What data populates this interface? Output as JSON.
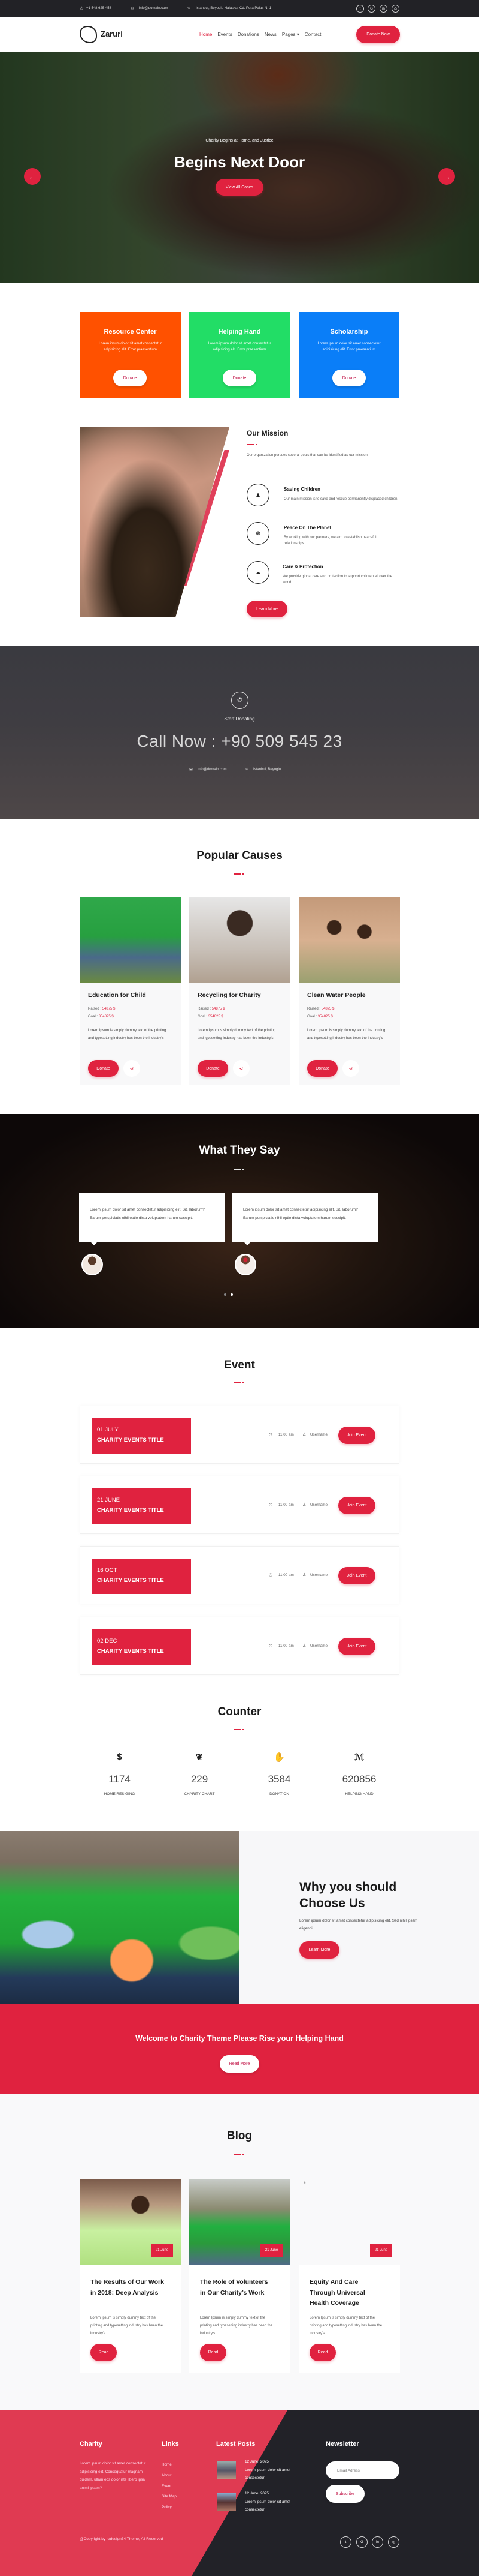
{
  "colors": {
    "accent": "#e0223f",
    "orange": "#ff5100",
    "green": "#22dd66",
    "blue": "#0a7ef8",
    "dark": "#222228",
    "footer_red": "#e03a52"
  },
  "topbar": {
    "phone": "+1 548 625 458",
    "email": "info@domain.com",
    "address": "Istanbul, Beyoglu Halaskar Cd. Pera Palas N. 1",
    "social": [
      "twitter-icon",
      "google-icon",
      "linkedin-icon",
      "instagram-icon"
    ]
  },
  "header": {
    "brand": "Zaruri",
    "nav": [
      "Home",
      "Events",
      "Donations",
      "News",
      "Pages",
      "Contact"
    ],
    "active": "Home",
    "donate_label": "Donate Now"
  },
  "hero": {
    "subtitle": "Charity Begins at Home, and Justice",
    "title": "Begins Next Door",
    "button": "View All Cases"
  },
  "features": [
    {
      "title": "Resource Center",
      "text": "Lorem ipsum dolor sit amet consectetur adipisicing elit. Error praesentium",
      "button": "Donate"
    },
    {
      "title": "Helping Hand",
      "text": "Lorem ipsum dolor sit amet consectetur adipisicing elit. Error praesentium",
      "button": "Donate"
    },
    {
      "title": "Scholarship",
      "text": "Lorem ipsum dolor sit amet consectetur adipisicing elit. Error praesentium",
      "button": "Donate"
    }
  ],
  "mission": {
    "title": "Our Mission",
    "intro": "Our organization pursues several goals that can be identified as our mission.",
    "items": [
      {
        "title": "Saving Children",
        "text": "Our main mission is to save and rescue permanently displaced children."
      },
      {
        "title": "Peace On The Planet",
        "text": "By working with our partners, we aim to establish peaceful relationships."
      },
      {
        "title": "Care & Protection",
        "text": "We provide global care and protection to support children all over the world."
      }
    ],
    "button": "Learn More"
  },
  "call": {
    "label": "Start Donating",
    "headline": "Call Now : +90 509 545 23",
    "email": "info@domain.com",
    "location": "Istanbul, Beyoglu"
  },
  "causes": {
    "title": "Popular Causes",
    "items": [
      {
        "title": "Education for Child",
        "raised_label": "Raised : ",
        "raised": "54875 $",
        "goal_label": "Goal : ",
        "goal": "354825 $",
        "text": "Lorem Ipsum is simply dummy text of the printing and typesetting industry has been the industry's",
        "button": "Donate"
      },
      {
        "title": "Recycling for Charity",
        "raised_label": "Raised : ",
        "raised": "54875 $",
        "goal_label": "Goal : ",
        "goal": "354825 $",
        "text": "Lorem Ipsum is simply dummy text of the printing and typesetting industry has been the industry's",
        "button": "Donate"
      },
      {
        "title": "Clean Water People",
        "raised_label": "Raised : ",
        "raised": "54875 $",
        "goal_label": "Goal : ",
        "goal": "354825 $",
        "text": "Lorem Ipsum is simply dummy text of the printing and typesetting industry has been the industry's",
        "button": "Donate"
      }
    ]
  },
  "testimonials": {
    "title": "What They Say",
    "items": [
      {
        "text": "Lorem ipsum dolor sit amet consectetur adipisicing elit. Sit, laborum? Earum perspiciatis nihil optio dicta voluptatem harum suscipit."
      },
      {
        "text": "Lorem ipsum dolor sit amet consectetur adipisicing elit. Sit, laborum? Earum perspiciatis nihil optio dicta voluptatem harum suscipit."
      }
    ]
  },
  "events": {
    "title": "Event",
    "items": [
      {
        "date": "01 JULY",
        "title": "CHARITY EVENTS TITLE",
        "time": "11:00 am",
        "user": "Username",
        "button": "Join Event"
      },
      {
        "date": "21 JUNE",
        "title": "CHARITY EVENTS TITLE",
        "time": "11:00 am",
        "user": "Username",
        "button": "Join Event"
      },
      {
        "date": "16 OCT",
        "title": "CHARITY EVENTS TITLE",
        "time": "11:00 am",
        "user": "Username",
        "button": "Join Event"
      },
      {
        "date": "02 DEC",
        "title": "CHARITY EVENTS TITLE",
        "time": "11:00 am",
        "user": "Username",
        "button": "Join Event"
      }
    ]
  },
  "counter": {
    "title": "Counter",
    "items": [
      {
        "value": "1174",
        "label": "HOME RESIGING",
        "icon": "hand-dollar-icon"
      },
      {
        "value": "229",
        "label": "CHARITY CHART",
        "icon": "open-hands-icon"
      },
      {
        "value": "3584",
        "label": "DONATION",
        "icon": "handshake-icon"
      },
      {
        "value": "620856",
        "label": "HELPING HAND",
        "icon": "signature-icon"
      }
    ]
  },
  "why": {
    "title_line1": "Why you should",
    "title_line2": "Choose Us",
    "text": "Lorem ipsum dolor sit amet consectetur adipisicing elit. Sed nihil ipsam eligendi.",
    "button": "Learn More"
  },
  "banner": {
    "text": "Welcome to Charity Theme Please Rise your Helping Hand",
    "button": "Read More"
  },
  "blog": {
    "title": "Blog",
    "items": [
      {
        "date": "21 June",
        "title": "The Results of Our Work in 2018: Deep Analysis",
        "text": "Lorem Ipsum is simply dummy text of the printing and typesetting industry has been the industry's",
        "button": "Read"
      },
      {
        "date": "21 June",
        "title": "The Role of Volunteers in Our Charity’s Work",
        "text": "Lorem Ipsum is simply dummy text of the printing and typesetting industry has been the industry's",
        "button": "Read"
      },
      {
        "date": "21 June",
        "title": "Equity And Care Through Universal Health Coverage",
        "text": "Lorem Ipsum is simply dummy text of the printing and typesetting industry has been the industry's",
        "button": "Read",
        "image_alt": "#"
      }
    ]
  },
  "footer": {
    "about_title": "Charity",
    "about_text": "Lorem ipsum dolor sit amet consectetur adipisicing elit. Consequatur magnam quidem, ullam eos dolor iste libero ipsa animi ipsam?",
    "links_title": "Links",
    "links": [
      "Home",
      "About",
      "Event",
      "Site Map",
      "Policy"
    ],
    "posts_title": "Latest Posts",
    "posts": [
      {
        "date": "12 June, 2025",
        "text": "Lorem ipsum dolor sit amet consectetur"
      },
      {
        "date": "12 June, 2025",
        "text": "Lorem ipsum dolor sit amet consectetur"
      }
    ],
    "newsletter_title": "Newsletter",
    "email_placeholder": "Email Adress",
    "subscribe": "Subscribe",
    "copyright": "@Copyright by redesign34 Theme, All Reserved"
  }
}
